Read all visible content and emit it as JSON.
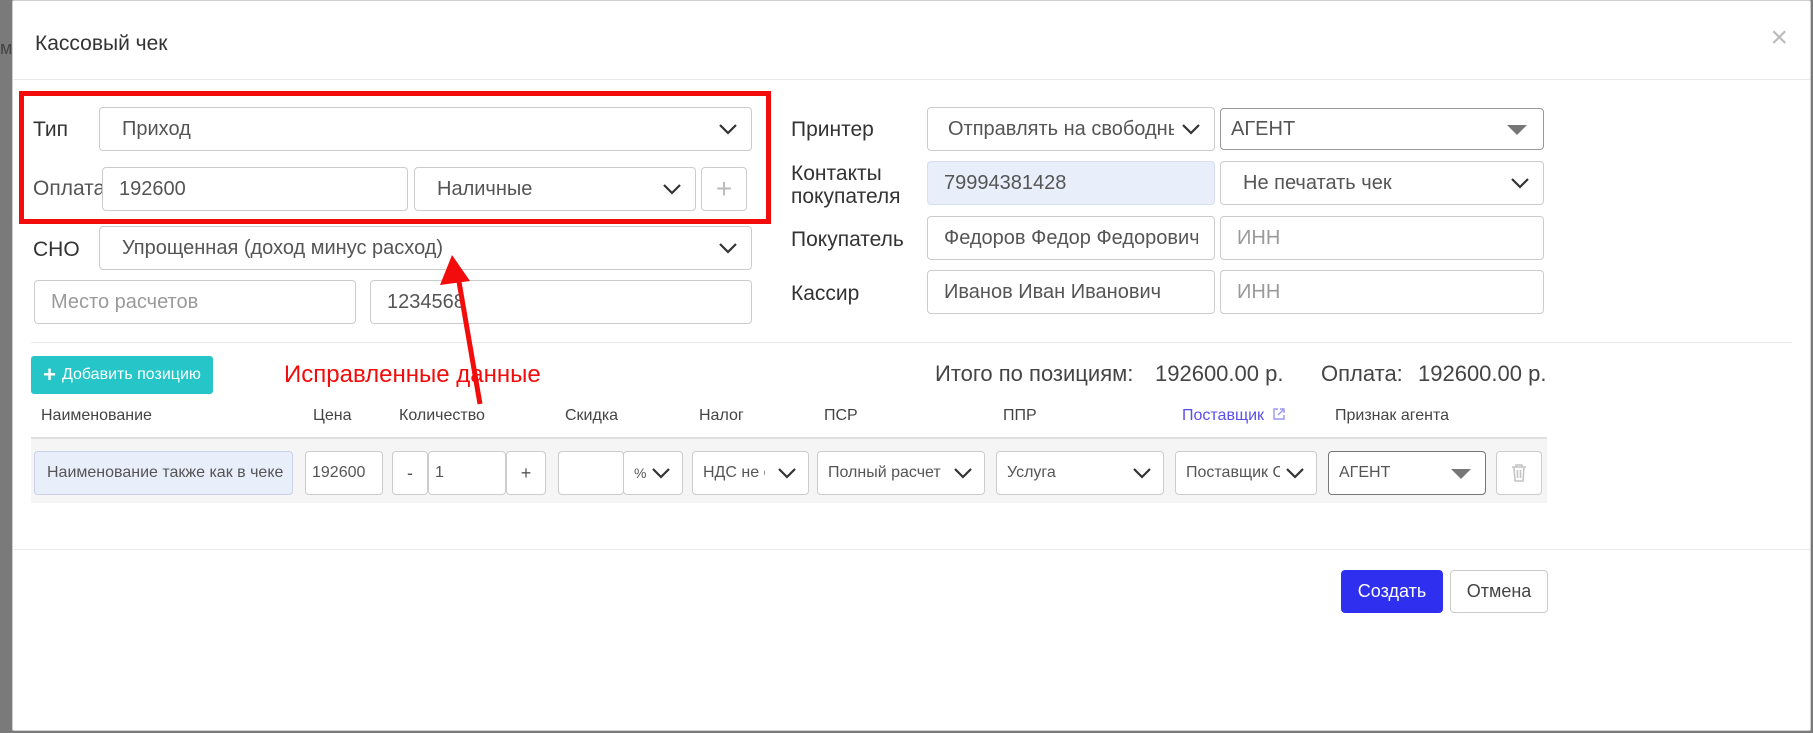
{
  "background_peek": "ме",
  "modal": {
    "title": "Кассовый чек",
    "close_glyph": "×"
  },
  "left_form": {
    "type_label": "Тип",
    "type_value": "Приход",
    "payment_label": "Оплата",
    "payment_amount": "192600",
    "payment_method": "Наличные",
    "add_payment_glyph": "+",
    "tax_system_label": "СНО",
    "tax_system_value": "Упрощенная (доход минус расход)",
    "settlement_place_placeholder": "Место расчетов",
    "settlement_code": "1234568"
  },
  "right_form": {
    "printer_label": "Принтер",
    "printer_value": "Отправлять на свободный",
    "agent_value": "АГЕНТ",
    "contacts_label_line1": "Контакты",
    "contacts_label_line2": "покупателя",
    "contacts_value": "79994381428",
    "print_mode_value": "Не печатать чек",
    "buyer_label": "Покупатель",
    "buyer_value": "Федоров Федор Федорович",
    "buyer_inn_placeholder": "ИНН",
    "cashier_label": "Кассир",
    "cashier_value": "Иванов Иван Иванович",
    "cashier_inn_placeholder": "ИНН"
  },
  "annotation": {
    "text": "Исправленные данные",
    "color": "#f20c0c"
  },
  "positions": {
    "add_button_label": "Добавить позицию",
    "total_label": "Итого по позициям:",
    "total_value": "192600.00 р.",
    "payment_label": "Оплата:",
    "payment_value": "192600.00 р.",
    "columns": [
      "Наименование",
      "Цена",
      "Количество",
      "Скидка",
      "Налог",
      "ПСР",
      "ППР",
      "Поставщик",
      "Признак агента"
    ],
    "row": {
      "name": "Наименование также как в чеке",
      "price": "192600",
      "qty_minus": "-",
      "qty": "1",
      "qty_plus": "+",
      "discount": "",
      "discount_unit": "%",
      "tax": "НДС не облагается",
      "psr": "Полный расчет",
      "ppr": "Услуга",
      "supplier": "Поставщик ООО",
      "agent_sign": "АГЕНТ"
    }
  },
  "footer": {
    "create_label": "Создать",
    "cancel_label": "Отмена"
  },
  "colors": {
    "accent_teal": "#26c6c8",
    "primary_blue": "#2f2ff0",
    "link_purple": "#5a4ef0",
    "filled_field_bg": "#e8effb"
  }
}
